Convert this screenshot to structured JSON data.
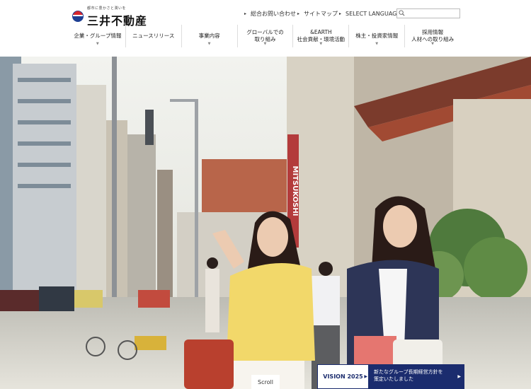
{
  "logo": {
    "tagline": "都市に豊かさと潤いを",
    "name": "三井不動産"
  },
  "utility": {
    "contact": "総合お問い合わせ",
    "sitemap": "サイトマップ",
    "language": "SELECT LANGUAGE",
    "search_value": ""
  },
  "nav": [
    {
      "line1": "企業・グループ情報",
      "line2": ""
    },
    {
      "line1": "ニュースリリース",
      "line2": ""
    },
    {
      "line1": "事業内容",
      "line2": ""
    },
    {
      "line1": "グローバルでの",
      "line2": "取り組み"
    },
    {
      "line1": "&EARTH",
      "line2": "社会貢献・環境活動"
    },
    {
      "line1": "株主・投資家情報",
      "line2": ""
    },
    {
      "line1": "採用情報",
      "line2": "人材への取り組み"
    }
  ],
  "hero": {
    "signage": "MITSUKOSHI"
  },
  "scroll": "Scroll",
  "vision": {
    "title": "VISION 2025",
    "line1": "新たなグループ長期経営方針を",
    "line2": "策定いたしました"
  },
  "colors": {
    "navy": "#1b2c6e",
    "logo_red": "#d7262d",
    "logo_blue": "#1d3f93"
  }
}
